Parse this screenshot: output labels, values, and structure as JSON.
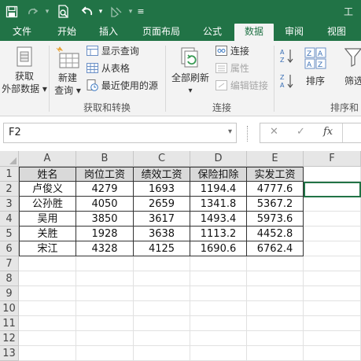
{
  "document_title": "工资",
  "tabs": [
    {
      "label": "文件",
      "active": false
    },
    {
      "label": "开始",
      "active": false
    },
    {
      "label": "插入",
      "active": false
    },
    {
      "label": "页面布局",
      "active": false
    },
    {
      "label": "公式",
      "active": false
    },
    {
      "label": "数据",
      "active": true
    },
    {
      "label": "审阅",
      "active": false
    },
    {
      "label": "视图",
      "active": false
    }
  ],
  "ribbon": {
    "get_external_data": {
      "line1": "获取",
      "line2": "外部数据"
    },
    "new_query": {
      "line1": "新建",
      "line2": "查询"
    },
    "show_queries": "显示查询",
    "from_table": "从表格",
    "recent_sources": "最近使用的源",
    "group_get_transform": "获取和转换",
    "refresh_all": "全部刷新",
    "connections": "连接",
    "properties": "属性",
    "edit_links": "编辑链接",
    "group_connections": "连接",
    "sort": "排序",
    "filter": "筛选",
    "group_sort_filter": "排序和"
  },
  "formula_bar": {
    "name_box": "F2",
    "cancel_glyph": "✕",
    "enter_glyph": "✓",
    "fx_glyph": "fx",
    "formula_value": ""
  },
  "grid": {
    "columns": [
      "A",
      "B",
      "C",
      "D",
      "E",
      "F"
    ],
    "row_numbers": [
      "1",
      "2",
      "3",
      "4",
      "5",
      "6",
      "7",
      "8",
      "9",
      "10",
      "11",
      "12",
      "13"
    ],
    "header": [
      "姓名",
      "岗位工资",
      "绩效工资",
      "保险扣除",
      "实发工资"
    ],
    "rows": [
      [
        "卢俊义",
        "4279",
        "1693",
        "1194.4",
        "4777.6"
      ],
      [
        "公孙胜",
        "4050",
        "2659",
        "1341.8",
        "5367.2"
      ],
      [
        "吴用",
        "3850",
        "3617",
        "1493.4",
        "5973.6"
      ],
      [
        "关胜",
        "1928",
        "3638",
        "1113.2",
        "4452.8"
      ],
      [
        "宋江",
        "4328",
        "4125",
        "1690.6",
        "6762.4"
      ]
    ],
    "selected_cell": "F2"
  },
  "colors": {
    "accent": "#217346",
    "ribbon_bg": "#f3f3f3",
    "header_fill": "#d9d9d9"
  }
}
